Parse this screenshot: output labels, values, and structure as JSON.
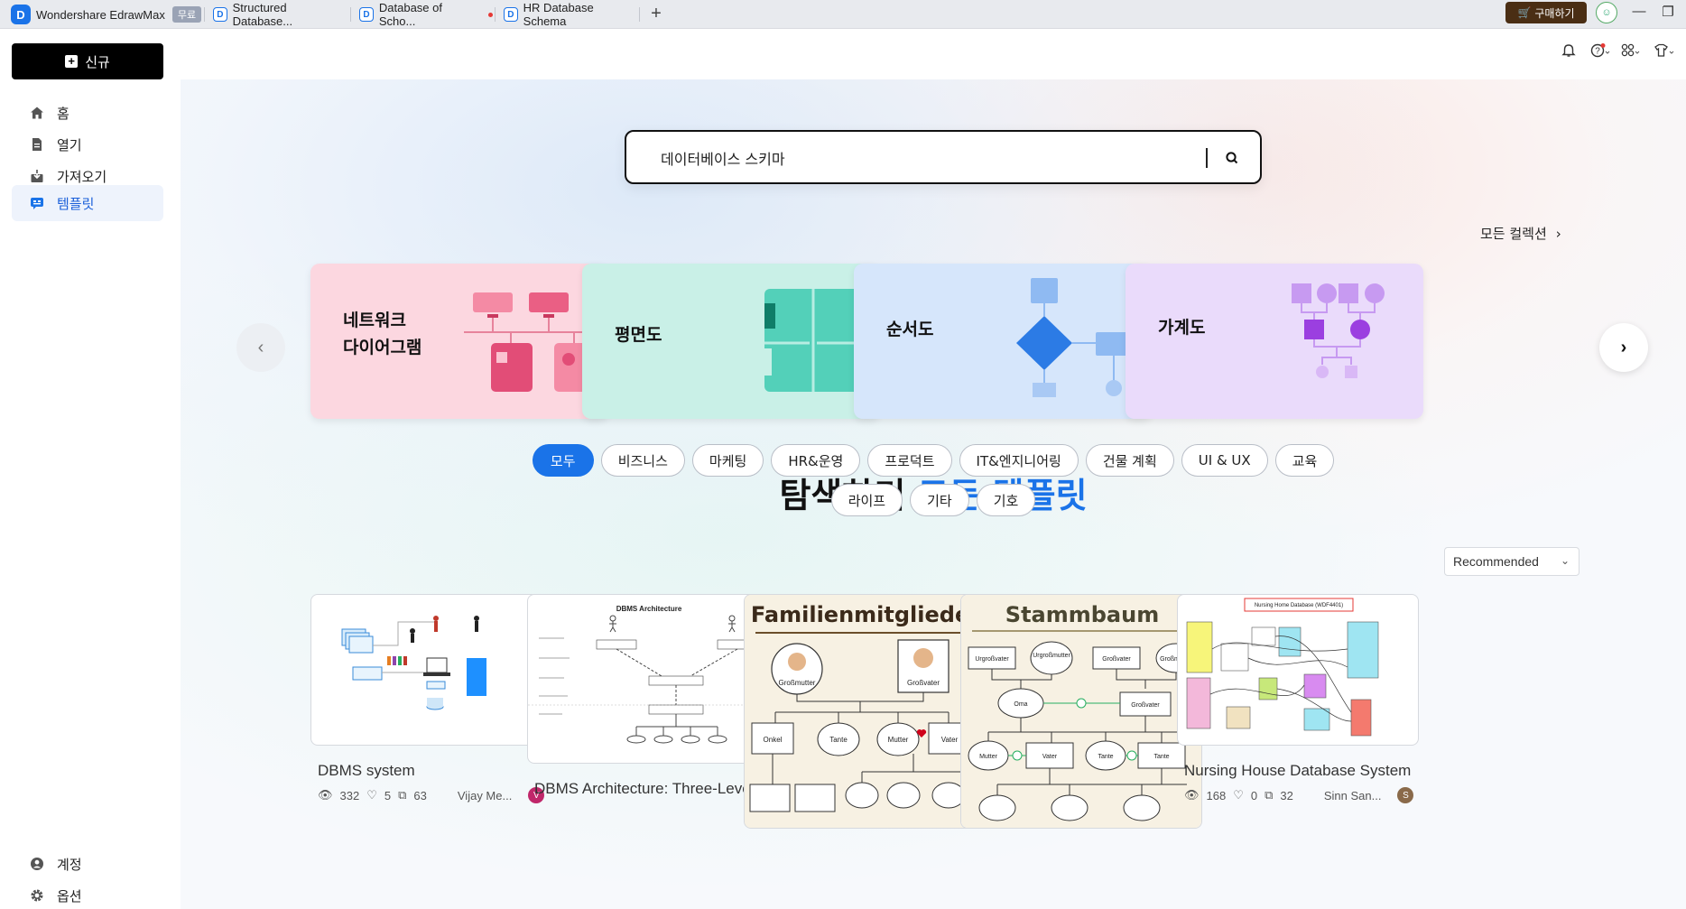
{
  "titlebar": {
    "app_name": "Wondershare EdrawMax",
    "app_badge": "무료",
    "tabs": [
      {
        "label": "Structured Database..."
      },
      {
        "label": "Database of Scho..."
      },
      {
        "label": "HR Database Schema"
      }
    ],
    "buy_label": "구매하기"
  },
  "sidebar": {
    "new_label": "신규",
    "items": [
      {
        "label": "홈",
        "icon": "home-icon"
      },
      {
        "label": "열기",
        "icon": "file-icon"
      },
      {
        "label": "가져오기",
        "icon": "import-icon"
      },
      {
        "label": "템플릿",
        "icon": "template-icon",
        "active": true
      }
    ],
    "bottom_items": [
      {
        "label": "계정",
        "icon": "account-icon"
      },
      {
        "label": "옵션",
        "icon": "settings-icon"
      }
    ]
  },
  "search": {
    "value": "데이터베이스 스키마"
  },
  "collections": {
    "all_label": "모든 컬렉션",
    "cards": [
      {
        "label_line1": "네트워크",
        "label_line2": "다이어그램"
      },
      {
        "label_line1": "평면도",
        "label_line2": ""
      },
      {
        "label_line1": "순서도",
        "label_line2": ""
      },
      {
        "label_line1": "가계도",
        "label_line2": ""
      }
    ]
  },
  "explore": {
    "title_prefix": "탐색하기",
    "title_accent": "모든 템플릿"
  },
  "filters": {
    "row1": [
      "모두",
      "비즈니스",
      "마케팅",
      "HR&운영",
      "프로덕트",
      "IT&엔지니어링",
      "건물 계획",
      "UI & UX",
      "교육"
    ],
    "row2": [
      "라이프",
      "기타",
      "기호"
    ],
    "active": "모두"
  },
  "sort": {
    "selected": "Recommended"
  },
  "templates": [
    {
      "name": "DBMS system",
      "views": "332",
      "likes": "5",
      "copies": "63",
      "author": "Vijay Me..."
    },
    {
      "name": "DBMS Architecture: Three-Level",
      "views": "",
      "likes": "",
      "copies": "",
      "author": ""
    },
    {
      "name": "",
      "thumb_title": "Familienmitglieder",
      "views": "",
      "likes": "",
      "copies": "",
      "author": ""
    },
    {
      "name": "",
      "thumb_title": "Stammbaum",
      "views": "",
      "likes": "",
      "copies": "",
      "author": ""
    },
    {
      "name": "Nursing House Database System",
      "views": "168",
      "likes": "0",
      "copies": "32",
      "author": "Sinn San..."
    }
  ],
  "thumb_text": {
    "dbms_arch_title": "DBMS Architecture",
    "nursing_title": "Nursing Home Database (WDF4401)",
    "fam_nodes": [
      "Großmutter",
      "Großvater",
      "Onkel",
      "Tante",
      "Mutter",
      "Vater"
    ],
    "stamm_nodes": [
      "Urgroßvater",
      "Urgroßmutter",
      "Großvater",
      "Großmutter",
      "Oma",
      "Großvater",
      "Mutter",
      "Vater",
      "Tante",
      "Tante"
    ]
  }
}
